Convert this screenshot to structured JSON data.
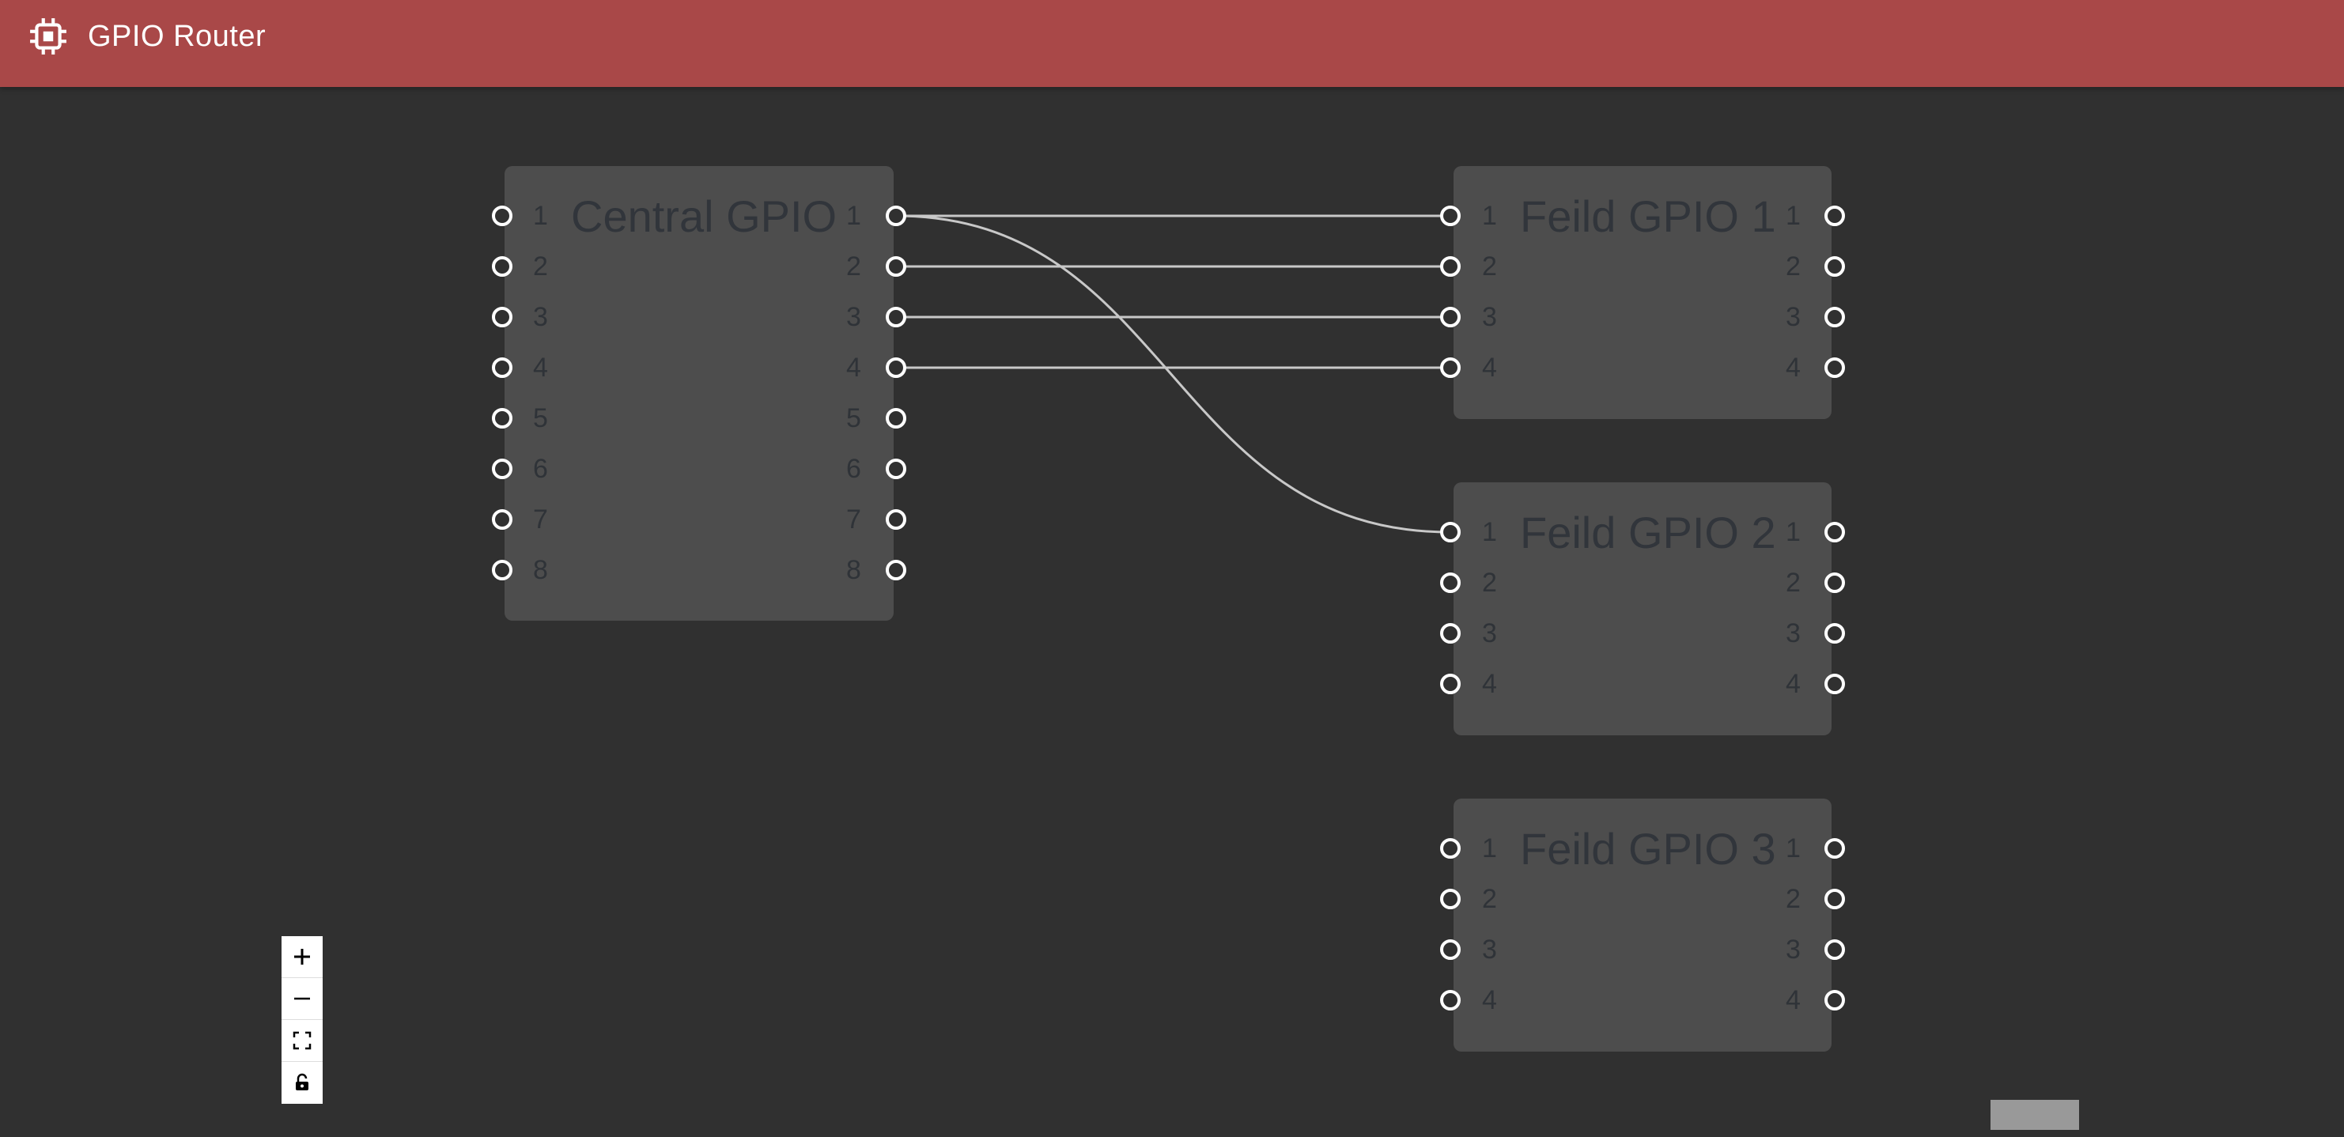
{
  "app": {
    "title": "GPIO Router",
    "icon": "chip-icon",
    "bar_color": "#a94848"
  },
  "canvas": {
    "background": "#303030",
    "node_color": "#4d4d4d",
    "edge_color": "#c8c8c8"
  },
  "nodes": [
    {
      "id": "central",
      "title": "Central GPIO",
      "inputs": [
        "1",
        "2",
        "3",
        "4",
        "5",
        "6",
        "7",
        "8"
      ],
      "outputs": [
        "1",
        "2",
        "3",
        "4",
        "5",
        "6",
        "7",
        "8"
      ]
    },
    {
      "id": "field1",
      "title": "Feild GPIO 1",
      "inputs": [
        "1",
        "2",
        "3",
        "4"
      ],
      "outputs": [
        "1",
        "2",
        "3",
        "4"
      ]
    },
    {
      "id": "field2",
      "title": "Feild GPIO 2",
      "inputs": [
        "1",
        "2",
        "3",
        "4"
      ],
      "outputs": [
        "1",
        "2",
        "3",
        "4"
      ]
    },
    {
      "id": "field3",
      "title": "Feild GPIO 3",
      "inputs": [
        "1",
        "2",
        "3",
        "4"
      ],
      "outputs": [
        "1",
        "2",
        "3",
        "4"
      ]
    }
  ],
  "connections": [
    {
      "from": "Central GPIO 1",
      "to": "Feild GPIO 1 · 1"
    },
    {
      "from": "Central GPIO 2",
      "to": "Feild GPIO 1 · 2"
    },
    {
      "from": "Central GPIO 3",
      "to": "Feild GPIO 1 · 3"
    },
    {
      "from": "Central GPIO 4",
      "to": "Feild GPIO 1 · 4"
    },
    {
      "from": "Central GPIO 1",
      "to": "Feild GPIO 2 · 1"
    }
  ],
  "controls": {
    "zoom_in": "plus-icon",
    "zoom_out": "minus-icon",
    "fit_view": "fit-view-icon",
    "lock": "unlock-icon"
  }
}
